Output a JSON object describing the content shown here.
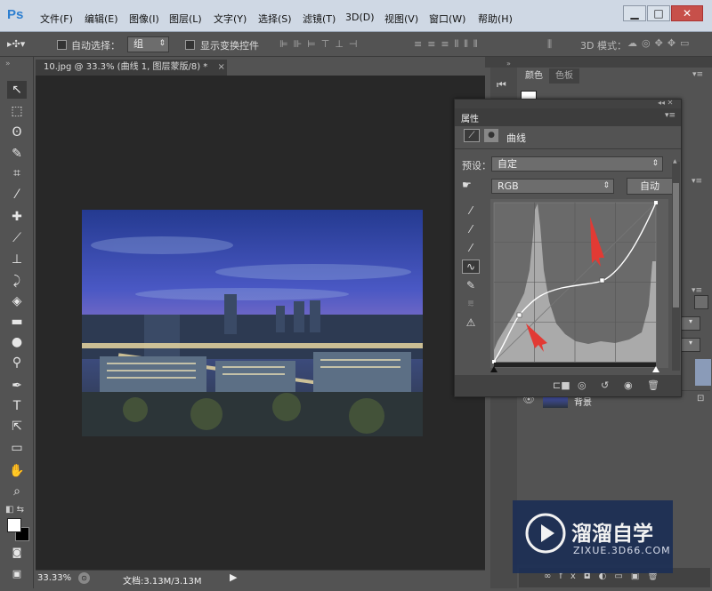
{
  "app": {
    "logo": "Ps"
  },
  "menu": [
    "文件(F)",
    "编辑(E)",
    "图像(I)",
    "图层(L)",
    "文字(Y)",
    "选择(S)",
    "滤镜(T)",
    "3D(D)",
    "视图(V)",
    "窗口(W)",
    "帮助(H)"
  ],
  "window_controls": {
    "minimize": "▁",
    "maximize": "□",
    "close": "✕"
  },
  "options": {
    "auto_select_label": "自动选择：",
    "auto_select_value": "组",
    "show_transform_label": "显示变换控件",
    "mode_3d_label": "3D 模式："
  },
  "document": {
    "tab_title": "10.jpg @ 33.3% (曲线 1, 图层蒙版/8) *",
    "tab_close": "×",
    "zoom": "33.33%",
    "doc_info": "文档:3.13M/3.13M"
  },
  "dock": {
    "color_tab": "颜色",
    "swatches_tab": "色板",
    "layer_name": "背景"
  },
  "properties": {
    "title": "属性",
    "adjust_name": "曲线",
    "preset_label": "预设：",
    "preset_value": "自定",
    "channel_value": "RGB",
    "auto_label": "自动"
  },
  "watermark": {
    "brand": "溜溜自学",
    "url": "ZIXUE.3D66.COM"
  },
  "colors": {
    "accent_red": "#e23a34",
    "menubar": "#cfd8e4",
    "panel": "#535353",
    "canvas": "#282828"
  },
  "icons": [
    "move-tool",
    "marquee-tool",
    "lasso-tool",
    "quick-select-tool",
    "crop-tool",
    "eyedropper-tool",
    "healing-tool",
    "brush-tool",
    "stamp-tool",
    "history-brush-tool",
    "eraser-tool",
    "gradient-tool",
    "blur-tool",
    "dodge-tool",
    "pen-tool",
    "type-tool",
    "path-select-tool",
    "shape-tool",
    "hand-tool",
    "zoom-tool"
  ]
}
